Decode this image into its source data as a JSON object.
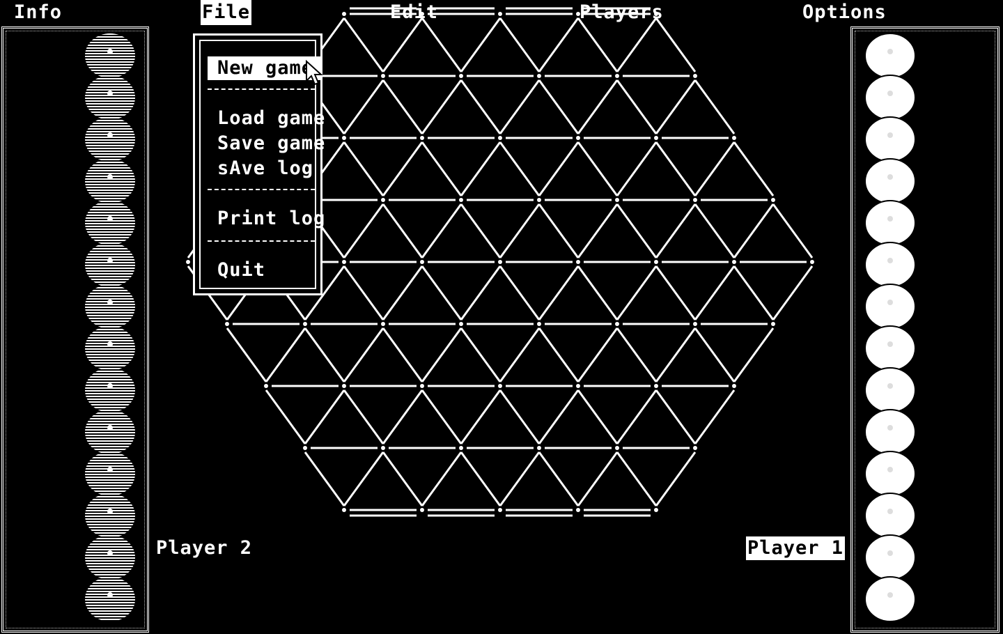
{
  "menubar": {
    "items": [
      {
        "label": "Info",
        "active": false
      },
      {
        "label": "File",
        "active": true
      },
      {
        "label": "Edit",
        "active": false
      },
      {
        "label": "Players",
        "active": false
      },
      {
        "label": "Options",
        "active": false
      }
    ]
  },
  "file_menu": {
    "items": [
      "New game",
      "Load game",
      "Save game",
      "sAve log",
      "Print log",
      "Quit"
    ],
    "selected": "New game"
  },
  "players": {
    "left_label": "Player 2",
    "right_label": "Player 1",
    "active_player": "Player 1"
  },
  "trays": {
    "left_marble_count": 14,
    "right_marble_count": 14,
    "left_marble_style": "striped",
    "right_marble_style": "solid"
  },
  "board": {
    "shape": "hexagon",
    "rows": 9,
    "colors": {
      "background": "#000000",
      "lines": "#ffffff"
    }
  },
  "icons": {
    "cursor": "mouse-pointer-icon",
    "marble": "marble-icon"
  }
}
